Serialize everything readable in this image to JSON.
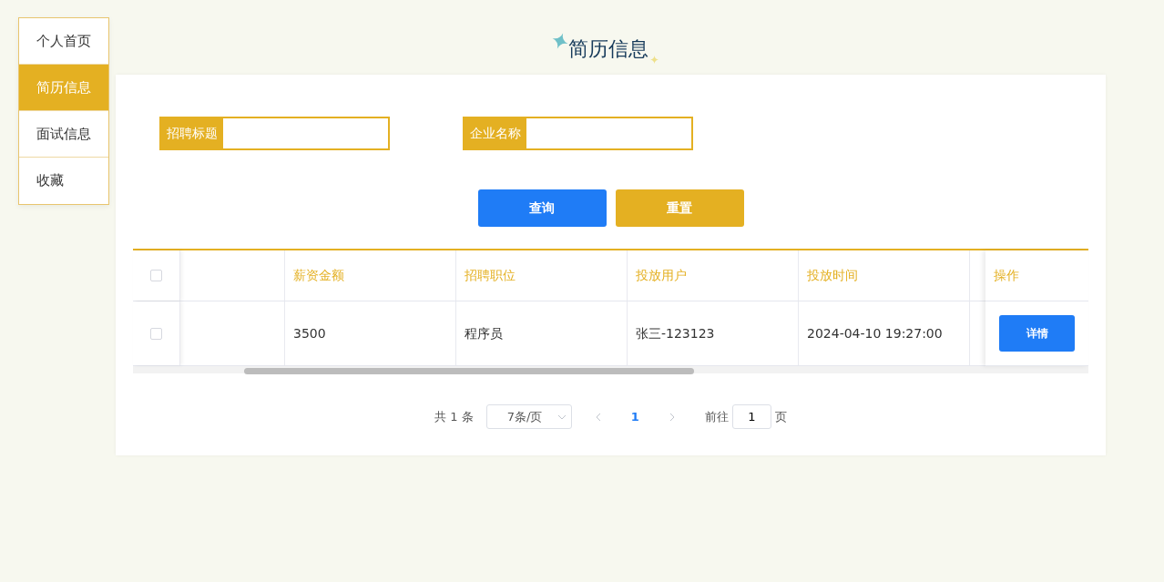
{
  "sidebar": {
    "items": [
      {
        "label": "个人首页",
        "selected": false
      },
      {
        "label": "简历信息",
        "selected": true
      },
      {
        "label": "面试信息",
        "selected": false
      },
      {
        "label": "收藏",
        "selected": false
      }
    ]
  },
  "page_title": "简历信息",
  "search": {
    "fields": [
      {
        "label": "招聘标题"
      },
      {
        "label": "企业名称"
      }
    ],
    "buttons": [
      {
        "label": "查询",
        "kind": "primary"
      },
      {
        "label": "重置",
        "kind": "reset"
      }
    ]
  },
  "table": {
    "select_all_checked": false,
    "columns": [
      "薪资金额",
      "招聘职位",
      "投放用户",
      "投放时间"
    ],
    "action_column": "操作",
    "rows": [
      {
        "checked": false,
        "cells": [
          "3500",
          "程序员",
          "张三-123123",
          "2024-04-10 19:27:00"
        ],
        "action": "详情"
      }
    ]
  },
  "pagination": {
    "total": "共 1 条",
    "page_size": "7条/页",
    "pages": [
      {
        "label": "1",
        "selected": true
      }
    ],
    "goto_label": "前往",
    "goto_value": "1",
    "page_unit": "页"
  }
}
